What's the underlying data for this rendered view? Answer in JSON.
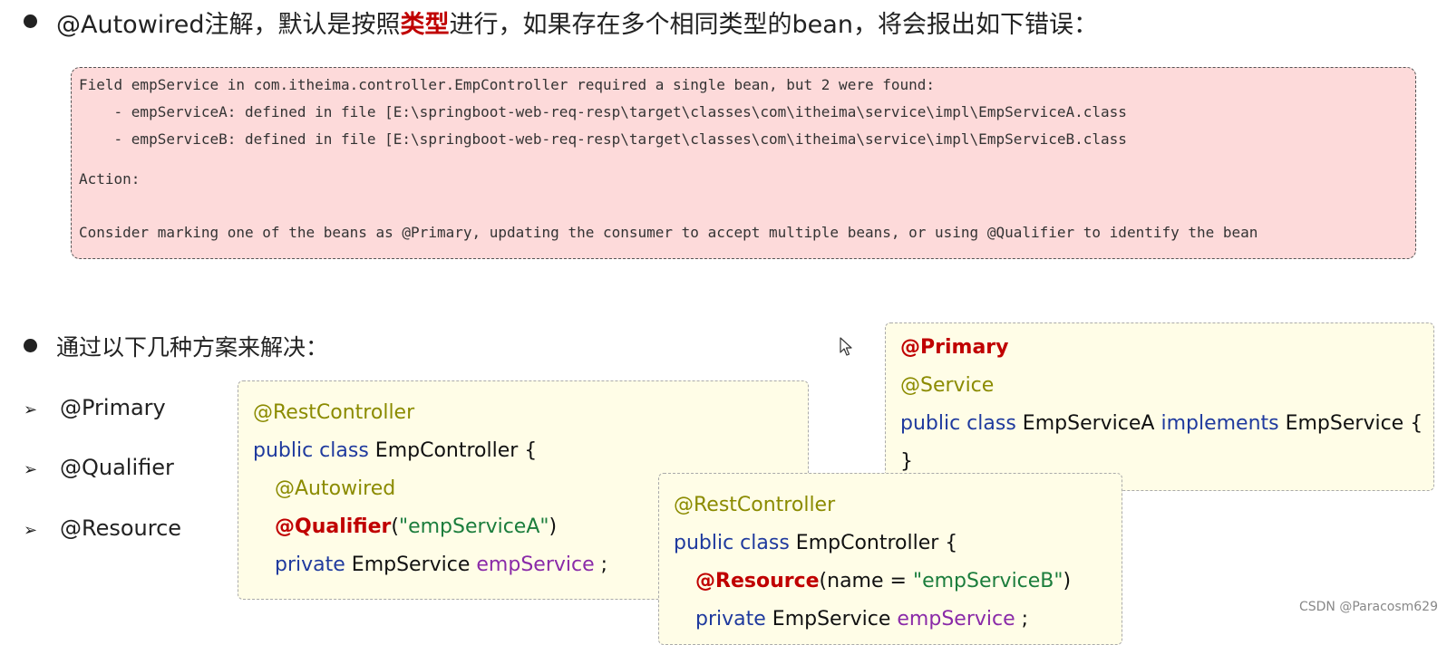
{
  "heading1": {
    "prefix": "@Autowired注解，默认是按照",
    "highlight": "类型",
    "suffix": "进行，如果存在多个相同类型的bean，将会报出如下错误："
  },
  "error_box": {
    "line1": "Field empService in com.itheima.controller.EmpController required a single bean, but 2 were found:",
    "line2": "    - empServiceA: defined in file [E:\\springboot-web-req-resp\\target\\classes\\com\\itheima\\service\\impl\\EmpServiceA.class",
    "line3": "    - empServiceB: defined in file [E:\\springboot-web-req-resp\\target\\classes\\com\\itheima\\service\\impl\\EmpServiceB.class",
    "line4": "Action:",
    "line5": "Consider marking one of the beans as @Primary, updating the consumer to accept multiple beans, or using @Qualifier to identify the bean"
  },
  "heading2": "通过以下几种方案来解决：",
  "solutions": [
    "@Primary",
    "@Qualifier",
    "@Resource"
  ],
  "arrow_glyph": "➢",
  "code_qualifier": {
    "ann": "@RestController",
    "kw_class": "public class",
    "class_name": " EmpController {",
    "autowired": "@Autowired",
    "qualifier": "@Qualifier",
    "q_open": "(",
    "q_value": "\"empServiceA\"",
    "q_close": ")",
    "kw_private": "private",
    "type_name": " EmpService ",
    "var_name": "empService",
    "semi": " ;"
  },
  "code_primary": {
    "primary": "@Primary",
    "service": "@Service",
    "kw_class": "public class",
    "class_name": " EmpServiceA ",
    "kw_impl": "implements",
    "iface": " EmpService {",
    "close": "}"
  },
  "code_resource": {
    "ann": "@RestController",
    "kw_class": "public class",
    "class_name": " EmpController {",
    "resource": "@Resource",
    "r_args": "(name = ",
    "r_value": "\"empServiceB\"",
    "r_close": ")",
    "kw_private": "private",
    "type_name": " EmpService ",
    "var_name": "empService",
    "semi": " ;"
  },
  "watermark": "CSDN @Paracosm629",
  "colors": {
    "highlight": "#c00000",
    "error_bg": "#fddada",
    "code_bg": "#fffde7",
    "annotation": "#8b8b00",
    "keyword": "#1f3a9e",
    "string": "#1b7d3c",
    "variable": "#8a2aa8"
  },
  "icons": {
    "cursor": "mouse-pointer-icon"
  }
}
